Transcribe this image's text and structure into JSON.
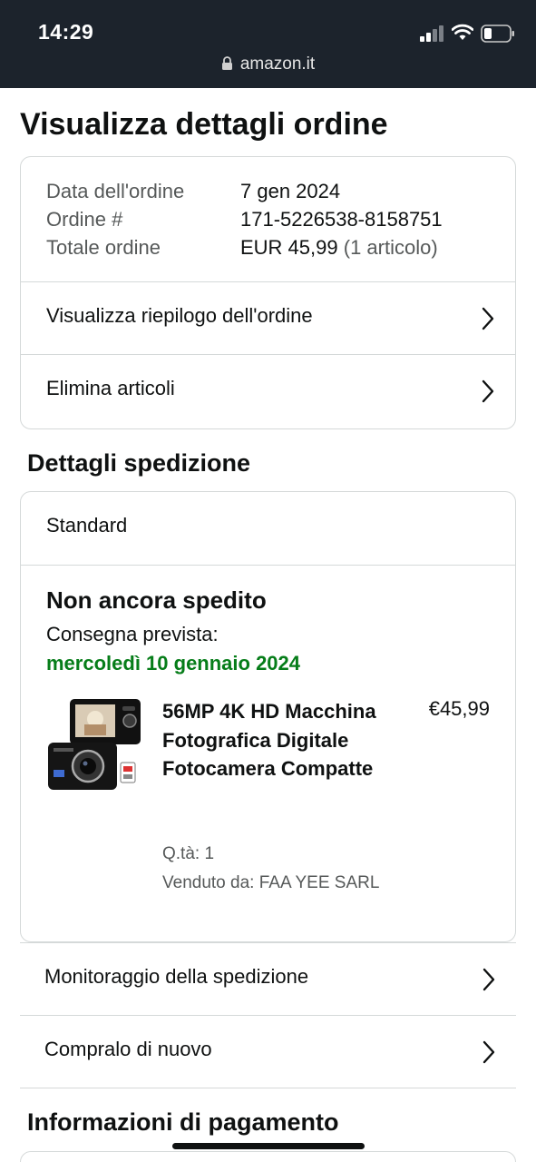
{
  "status_bar": {
    "time": "14:29",
    "url": "amazon.it"
  },
  "page": {
    "title": "Visualizza dettagli ordine"
  },
  "order_summary": {
    "date_label": "Data dell'ordine",
    "date_value": "7 gen 2024",
    "number_label": "Ordine #",
    "number_value": "171-5226538-8158751",
    "total_label": "Totale ordine",
    "total_value": "EUR 45,99",
    "total_items": "(1 articolo)",
    "links": [
      {
        "label": "Visualizza riepilogo dell'ordine"
      },
      {
        "label": "Elimina articoli"
      }
    ]
  },
  "shipping": {
    "section_title": "Dettagli spedizione",
    "method": "Standard",
    "status": "Non ancora spedito",
    "delivery_label": "Consegna prevista:",
    "delivery_date": "mercoledì 10 gennaio 2024",
    "delivery_color": "#067d19",
    "item": {
      "name": "56MP 4K HD Macchina Fotografica Digitale Fotocamera Compatte",
      "price": "€45,99",
      "qty": "Q.tà: 1",
      "seller": "Venduto da: FAA YEE SARL"
    }
  },
  "actions": [
    {
      "label": "Monitoraggio della spedizione"
    },
    {
      "label": "Compralo di nuovo"
    }
  ],
  "payment": {
    "section_title": "Informazioni di pagamento"
  },
  "colors": {
    "status_bar_bg": "#1c232c",
    "border": "#d5d9d9",
    "text": "#0f1111",
    "muted": "#565959"
  }
}
